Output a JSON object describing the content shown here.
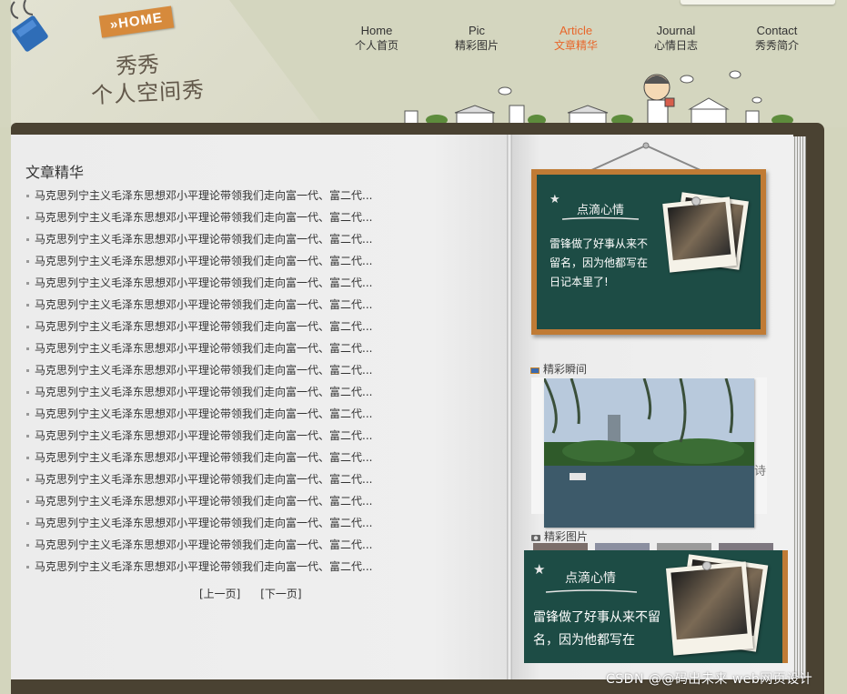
{
  "header": {
    "home_badge": "»HOME",
    "site_title_line1": "秀秀",
    "site_title_line2": "个人空间秀"
  },
  "nav": [
    {
      "en": "Home",
      "cn": "个人首页",
      "active": false
    },
    {
      "en": "Pic",
      "cn": "精彩图片",
      "active": false
    },
    {
      "en": "Article",
      "cn": "文章精华",
      "active": true
    },
    {
      "en": "Journal",
      "cn": "心情日志",
      "active": false
    },
    {
      "en": "Contact",
      "cn": "秀秀简介",
      "active": false
    }
  ],
  "article_section": {
    "title": "文章精华",
    "items": [
      "马克思列宁主义毛泽东思想邓小平理论带领我们走向富一代、富二代...",
      "马克思列宁主义毛泽东思想邓小平理论带领我们走向富一代、富二代...",
      "马克思列宁主义毛泽东思想邓小平理论带领我们走向富一代、富二代...",
      "马克思列宁主义毛泽东思想邓小平理论带领我们走向富一代、富二代...",
      "马克思列宁主义毛泽东思想邓小平理论带领我们走向富一代、富二代...",
      "马克思列宁主义毛泽东思想邓小平理论带领我们走向富一代、富二代...",
      "马克思列宁主义毛泽东思想邓小平理论带领我们走向富一代、富二代...",
      "马克思列宁主义毛泽东思想邓小平理论带领我们走向富一代、富二代...",
      "马克思列宁主义毛泽东思想邓小平理论带领我们走向富一代、富二代...",
      "马克思列宁主义毛泽东思想邓小平理论带领我们走向富一代、富二代...",
      "马克思列宁主义毛泽东思想邓小平理论带领我们走向富一代、富二代...",
      "马克思列宁主义毛泽东思想邓小平理论带领我们走向富一代、富二代...",
      "马克思列宁主义毛泽东思想邓小平理论带领我们走向富一代、富二代...",
      "马克思列宁主义毛泽东思想邓小平理论带领我们走向富一代、富二代...",
      "马克思列宁主义毛泽东思想邓小平理论带领我们走向富一代、富二代...",
      "马克思列宁主义毛泽东思想邓小平理论带领我们走向富一代、富二代...",
      "马克思列宁主义毛泽东思想邓小平理论带领我们走向富一代、富二代...",
      "马克思列宁主义毛泽东思想邓小平理论带领我们走向富一代、富二代..."
    ],
    "prev_label": "[上一页]",
    "next_label": "[下一页]"
  },
  "chalkboard": {
    "title": "点滴心情",
    "text": "雷锋做了好事从来不留名，因为他都写在日记本里了!"
  },
  "moments": {
    "heading": "精彩瞬间",
    "side_char": "诗"
  },
  "pictures": {
    "heading": "精彩图片"
  },
  "chalkboard_2": {
    "title": "点滴心情",
    "text": "雷锋做了好事从来不留名，因为他都写在"
  },
  "watermark": "CSDN @@码出未来 web网页设计",
  "colors": {
    "nav_active": "#e8662a",
    "chalkboard_green": "#1d4c45",
    "frame_orange": "#c07b35",
    "book_cover": "#4a4232",
    "header_bg": "#d4d6bf"
  }
}
